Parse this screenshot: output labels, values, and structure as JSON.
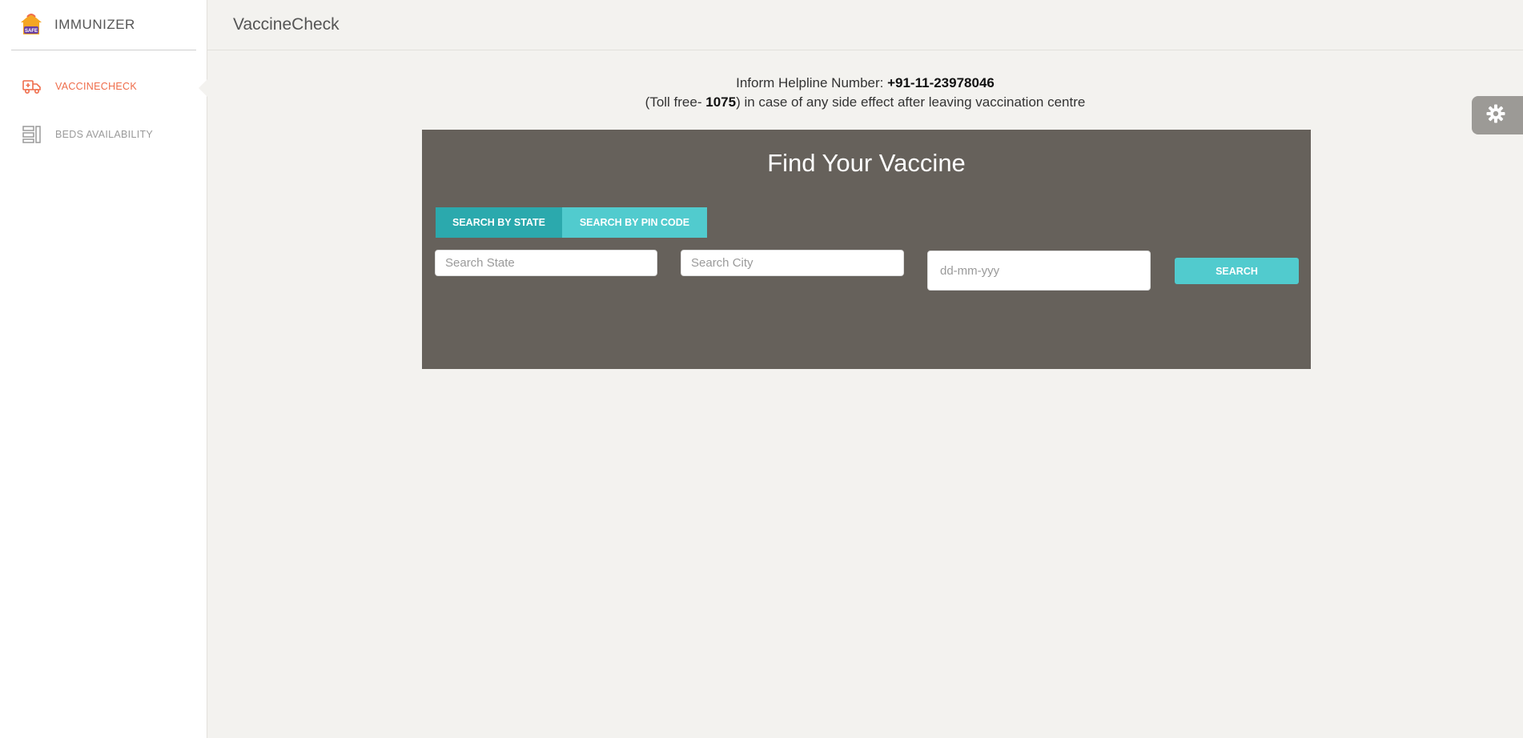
{
  "brand": {
    "name": "IMMUNIZER",
    "logo_text": "SAFE",
    "icon": "immunizer-logo-icon"
  },
  "sidebar": {
    "items": [
      {
        "label": "VACCINECHECK",
        "icon": "ambulance-icon",
        "active": true
      },
      {
        "label": "BEDS AVAILABILITY",
        "icon": "bed-list-icon",
        "active": false
      }
    ]
  },
  "header": {
    "title": "VaccineCheck"
  },
  "helpline": {
    "line1_prefix": "Inform Helpline Number: ",
    "number": "+91-11-23978046",
    "line2_prefix": "(Toll free- ",
    "toll_free": "1075",
    "line2_suffix": ") in case of any side effect after leaving vaccination centre"
  },
  "finder": {
    "title": "Find Your Vaccine",
    "tabs": [
      {
        "label": "SEARCH BY STATE",
        "active": true
      },
      {
        "label": "SEARCH BY PIN CODE",
        "active": false
      }
    ],
    "state_placeholder": "Search State",
    "city_placeholder": "Search City",
    "date_placeholder": "dd-mm-yyy",
    "search_label": "SEARCH"
  },
  "settings": {
    "icon": "gear-icon"
  },
  "colors": {
    "accent_orange": "#ef6c4a",
    "teal_dark": "#2ba9ad",
    "teal": "#51cbce",
    "panel": "#66615b",
    "background": "#f3f2ef"
  }
}
